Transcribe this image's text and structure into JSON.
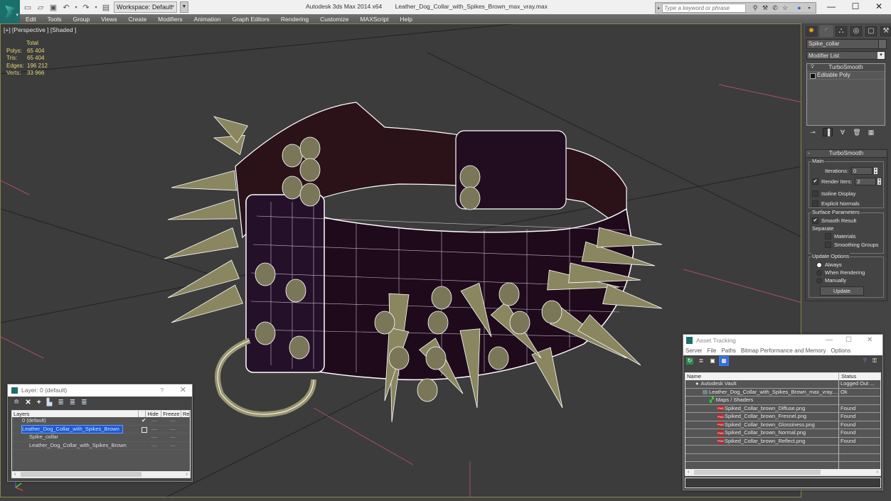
{
  "titlebar": {
    "app_title": "Autodesk 3ds Max  2014 x64",
    "file_name": "Leather_Dog_Collar_with_Spikes_Brown_max_vray.max",
    "workspace_label": "Workspace: Default",
    "search_placeholder": "Type a keyword or phrase",
    "minimize": "—",
    "maximize": "☐",
    "close": "✕"
  },
  "menubar": {
    "items": [
      "Edit",
      "Tools",
      "Group",
      "Views",
      "Create",
      "Modifiers",
      "Animation",
      "Graph Editors",
      "Rendering",
      "Customize",
      "MAXScript",
      "Help"
    ]
  },
  "viewport": {
    "label": "[+] [Perspective ] [Shaded ]",
    "stats": {
      "header": "Total",
      "rows": [
        {
          "key": "Polys:",
          "value": "65 404"
        },
        {
          "key": "Tris:",
          "value": "65 404"
        },
        {
          "key": "Edges:",
          "value": "196 212"
        },
        {
          "key": "Verts:",
          "value": "33 966"
        }
      ]
    }
  },
  "command_panel": {
    "object_name": "Spike_collar",
    "modifier_list": "Modifier List",
    "stack": [
      {
        "label": "TurboSmooth",
        "selected": true
      },
      {
        "label": "Editable Poly",
        "selected": false
      }
    ],
    "turbosmooth": {
      "title": "TurboSmooth",
      "main_group": "Main",
      "iterations_label": "Iterations:",
      "iterations_value": "0",
      "render_iters_label": "Render Iters:",
      "render_iters_value": "2",
      "render_iters_checked": true,
      "isoline_display": "Isoline Display",
      "explicit_normals": "Explicit Normals",
      "surface_group": "Surface Parameters",
      "smooth_result": "Smooth Result",
      "separate": "Separate",
      "materials": "Materials",
      "smoothing_groups": "Smoothing Groups",
      "update_group": "Update Options",
      "always": "Always",
      "when_rendering": "When Rendering",
      "manually": "Manually",
      "update_button": "Update"
    }
  },
  "layer_dialog": {
    "title": "Layer: 0 (default)",
    "help": "?",
    "close": "✕",
    "columns": [
      "Layers",
      "",
      "Hide",
      "Freeze",
      "Re"
    ],
    "rows": [
      {
        "name": "0 (default)",
        "indent": 1,
        "checked": true,
        "selected": false
      },
      {
        "name": "Leather_Dog_Collar_with_Spikes_Brown",
        "indent": 1,
        "checked": false,
        "selected": true
      },
      {
        "name": "Spike_collar",
        "indent": 2,
        "checked": false,
        "selected": false
      },
      {
        "name": "Leather_Dog_Collar_with_Spikes_Brown",
        "indent": 2,
        "checked": false,
        "selected": false
      }
    ]
  },
  "asset_tracking": {
    "title": "Asset Tracking",
    "menu": [
      "Server",
      "File",
      "Paths",
      "Bitmap Performance and Memory",
      "Options"
    ],
    "columns": [
      "Name",
      "Status"
    ],
    "rows": [
      {
        "name": "Autodesk Vault",
        "status": "Logged Out ...",
        "indent": 1,
        "icon": "vault"
      },
      {
        "name": "Leather_Dog_Collar_with_Spikes_Brown_max_vray....",
        "status": "Ok",
        "indent": 2,
        "icon": "max-file"
      },
      {
        "name": "Maps / Shaders",
        "status": "",
        "indent": 3,
        "icon": "maps"
      },
      {
        "name": "Spiked_Collar_brown_Diffuse.png",
        "status": "Found",
        "indent": 4,
        "icon": "png"
      },
      {
        "name": "Spiked_Collar_brown_Fresnel.png",
        "status": "Found",
        "indent": 4,
        "icon": "png"
      },
      {
        "name": "Spiked_Collar_brown_Glossiness.png",
        "status": "Found",
        "indent": 4,
        "icon": "png"
      },
      {
        "name": "Spiked_Collar_brown_Normal.png",
        "status": "Found",
        "indent": 4,
        "icon": "png"
      },
      {
        "name": "Spiked_Collar_brown_Reflect.png",
        "status": "Found",
        "indent": 4,
        "icon": "png"
      }
    ]
  },
  "colors": {
    "viewport_bg": "#3c3c3c",
    "viewport_border": "#8c8448",
    "stats_text": "#e6d67a",
    "selection_blue": "#1e5bd1",
    "leather": "#2a1020",
    "spike": "#8a8660",
    "wire": "#ffffff"
  }
}
